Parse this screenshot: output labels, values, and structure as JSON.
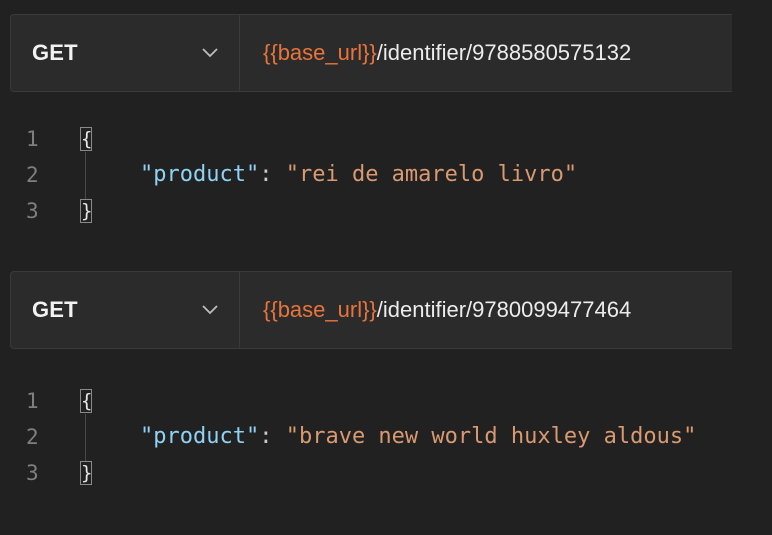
{
  "requests": [
    {
      "method": "GET",
      "url_variable": "{{base_url}}",
      "url_path": "/identifier/9788580575132",
      "response": {
        "line_numbers": [
          "1",
          "2",
          "3"
        ],
        "open_brace": "{",
        "close_brace": "}",
        "key": "\"product\"",
        "separator": ": ",
        "value": "\"rei de amarelo livro\""
      }
    },
    {
      "method": "GET",
      "url_variable": "{{base_url}}",
      "url_path": "/identifier/9780099477464",
      "response": {
        "line_numbers": [
          "1",
          "2",
          "3"
        ],
        "open_brace": "{",
        "close_brace": "}",
        "key": "\"product\"",
        "separator": ": ",
        "value": "\"brave new world huxley aldous\""
      }
    }
  ],
  "icons": {
    "method_dropdown": "chevron-down-icon"
  },
  "colors": {
    "background": "#212121",
    "bar_background": "#2b2b2b",
    "url_variable": "#e8743b",
    "json_key": "#8fd2f4",
    "json_string": "#d99a72"
  }
}
